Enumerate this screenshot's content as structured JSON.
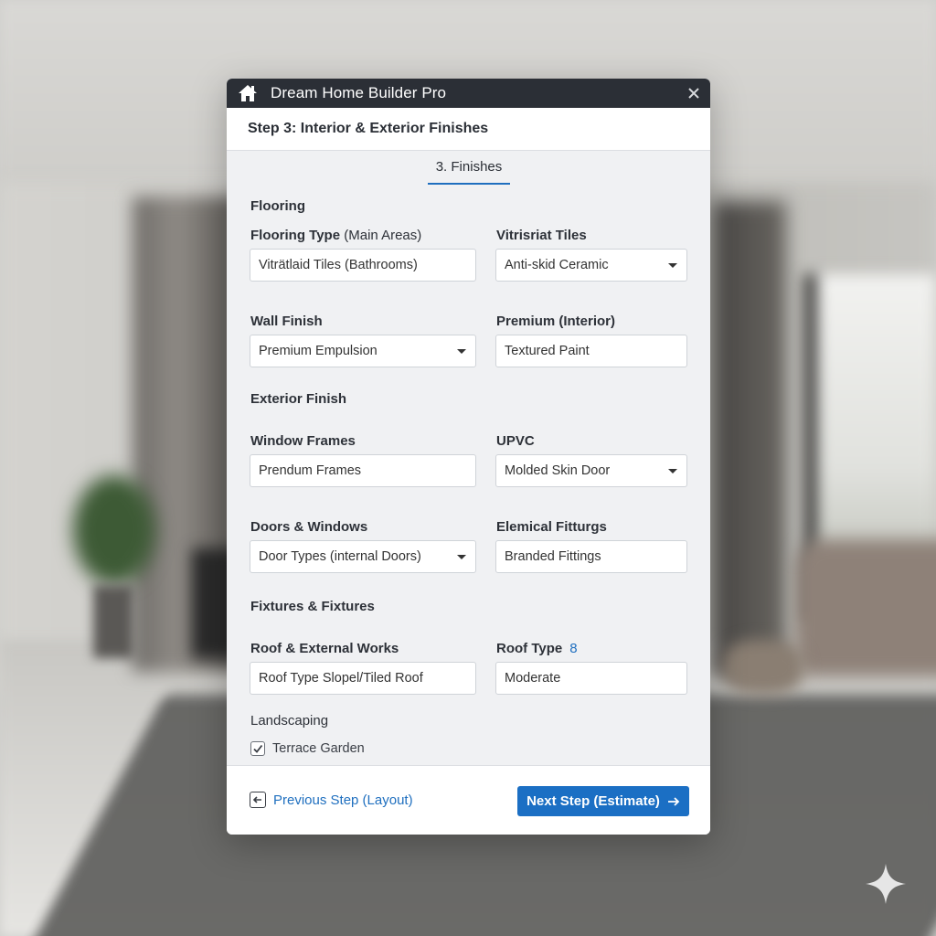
{
  "window": {
    "title": "Dream Home Builder Pro",
    "icon": "home-icon",
    "close_icon": "close-icon"
  },
  "step_header": "Step 3: Interior & Exterior Finishes",
  "tab": {
    "label": "3. Finishes"
  },
  "sections": {
    "flooring": "Flooring",
    "exterior_finish": "Exterior Finish",
    "fixtures": "Fixtures & Fixtures",
    "landscaping": "Landscaping"
  },
  "fields": {
    "flooring_type": {
      "label": "Flooring Type",
      "label_suffix": " (Main Areas)",
      "value": "Viträtlaid Tiles (Bathrooms)"
    },
    "vitrified_tiles": {
      "label": "Vitrisriat Tiles",
      "value": "Anti-skid Ceramic",
      "dropdown": true
    },
    "wall_finish": {
      "label": "Wall Finish",
      "value": "Premium Empulsion",
      "dropdown": true
    },
    "premium_interior": {
      "label": "Premium (Interior)",
      "value": "Textured Paint"
    },
    "window_frames": {
      "label": "Window Frames",
      "value": "Prendum Frames"
    },
    "upvc": {
      "label": "UPVC",
      "value": "Molded Skin Door",
      "dropdown": true
    },
    "doors_windows": {
      "label": "Doors & Windows",
      "value": "Door Types (internal Doors)",
      "dropdown": true
    },
    "electrical_fittings": {
      "label": "Elemical Fitturgs",
      "value": "Branded Fittings"
    },
    "roof_external": {
      "label": "Roof & External Works",
      "value": "Roof Type Slopel/Tiled Roof"
    },
    "roof_type": {
      "label": "Roof Type",
      "badge": "8",
      "value": "Moderate"
    }
  },
  "checkbox": {
    "label": "Terrace Garden",
    "checked": true
  },
  "footer": {
    "prev_label": "Previous Step (Layout)",
    "next_label": "Next Step (Estimate)"
  },
  "colors": {
    "accent": "#1b6fc4",
    "titlebar": "#2b2f36"
  }
}
